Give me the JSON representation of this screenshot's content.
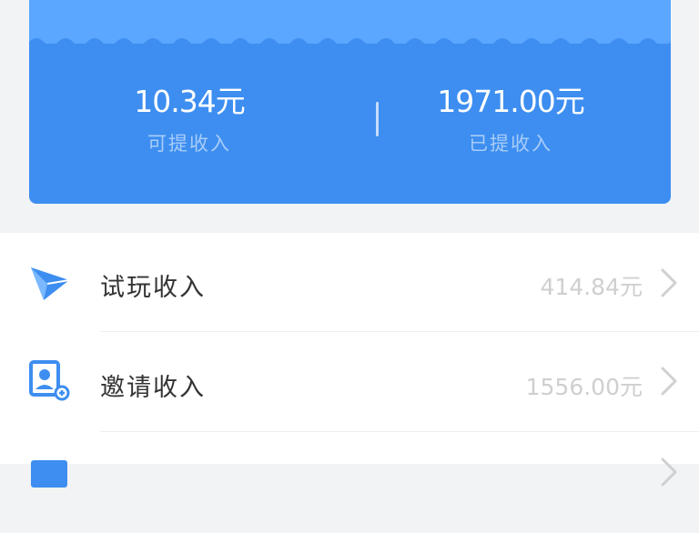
{
  "summary": {
    "pending_amount": "10.34元",
    "pending_label": "可提收入",
    "withdrawn_amount": "1971.00元",
    "withdrawn_label": "已提收入"
  },
  "income_list": [
    {
      "title": "试玩收入",
      "value": "414.84元",
      "icon": "paper-plane-icon"
    },
    {
      "title": "邀请收入",
      "value": "1556.00元",
      "icon": "invite-user-icon"
    },
    {
      "title": "",
      "value": "",
      "icon": "card-icon"
    }
  ],
  "colors": {
    "card_blue": "#3d8ef0",
    "card_light_blue": "#5ba6ff",
    "icon_blue": "#3d8ef0"
  }
}
